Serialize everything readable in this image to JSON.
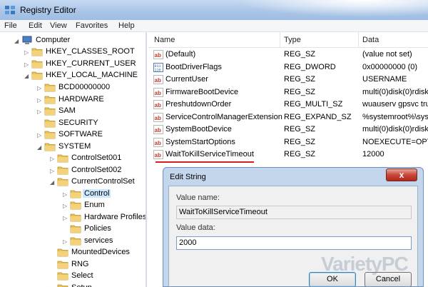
{
  "window": {
    "title": "Registry Editor"
  },
  "menu": [
    "File",
    "Edit",
    "View",
    "Favorites",
    "Help"
  ],
  "tree": [
    {
      "label": "Computer",
      "expander": "◢"
    },
    {
      "label": "HKEY_CLASSES_ROOT",
      "expander": "▷"
    },
    {
      "label": "HKEY_CURRENT_USER",
      "expander": "▷"
    },
    {
      "label": "HKEY_LOCAL_MACHINE",
      "expander": "◢"
    },
    {
      "label": "BCD00000000",
      "expander": "▷"
    },
    {
      "label": "HARDWARE",
      "expander": "▷"
    },
    {
      "label": "SAM",
      "expander": "▷"
    },
    {
      "label": "SECURITY",
      "expander": ""
    },
    {
      "label": "SOFTWARE",
      "expander": "▷"
    },
    {
      "label": "SYSTEM",
      "expander": "◢"
    },
    {
      "label": "ControlSet001",
      "expander": "▷"
    },
    {
      "label": "ControlSet002",
      "expander": "▷"
    },
    {
      "label": "CurrentControlSet",
      "expander": "◢"
    },
    {
      "label": "Control",
      "expander": "▷",
      "selected": true
    },
    {
      "label": "Enum",
      "expander": "▷"
    },
    {
      "label": "Hardware Profiles",
      "expander": "▷"
    },
    {
      "label": "Policies",
      "expander": ""
    },
    {
      "label": "services",
      "expander": "▷"
    },
    {
      "label": "MountedDevices",
      "expander": ""
    },
    {
      "label": "RNG",
      "expander": ""
    },
    {
      "label": "Select",
      "expander": ""
    },
    {
      "label": "Setup",
      "expander": "▷"
    }
  ],
  "list": {
    "headers": {
      "name": "Name",
      "type": "Type",
      "data": "Data"
    },
    "rows": [
      {
        "name": "(Default)",
        "type": "REG_SZ",
        "data": "(value not set)",
        "icon": "ab"
      },
      {
        "name": "BootDriverFlags",
        "type": "REG_DWORD",
        "data": "0x00000000 (0)",
        "icon": "bin"
      },
      {
        "name": "CurrentUser",
        "type": "REG_SZ",
        "data": "USERNAME",
        "icon": "ab"
      },
      {
        "name": "FirmwareBootDevice",
        "type": "REG_SZ",
        "data": "multi(0)disk(0)rdisk",
        "icon": "ab"
      },
      {
        "name": "PreshutdownOrder",
        "type": "REG_MULTI_SZ",
        "data": "wuauserv gpsvc tru",
        "icon": "ab"
      },
      {
        "name": "ServiceControlManagerExtension",
        "type": "REG_EXPAND_SZ",
        "data": "%systemroot%\\sys",
        "icon": "ab"
      },
      {
        "name": "SystemBootDevice",
        "type": "REG_SZ",
        "data": "multi(0)disk(0)rdisk",
        "icon": "ab"
      },
      {
        "name": "SystemStartOptions",
        "type": "REG_SZ",
        "data": " NOEXECUTE=OPT",
        "icon": "ab"
      },
      {
        "name": "WaitToKillServiceTimeout",
        "type": "REG_SZ",
        "data": "12000",
        "icon": "ab"
      }
    ]
  },
  "dialog": {
    "title": "Edit String",
    "close": "x",
    "value_name_label": "Value name:",
    "value_name": "WaitToKillServiceTimeout",
    "value_data_label": "Value data:",
    "value_data": "2000",
    "ok": "OK",
    "cancel": "Cancel"
  },
  "watermark": "VarietyPC"
}
